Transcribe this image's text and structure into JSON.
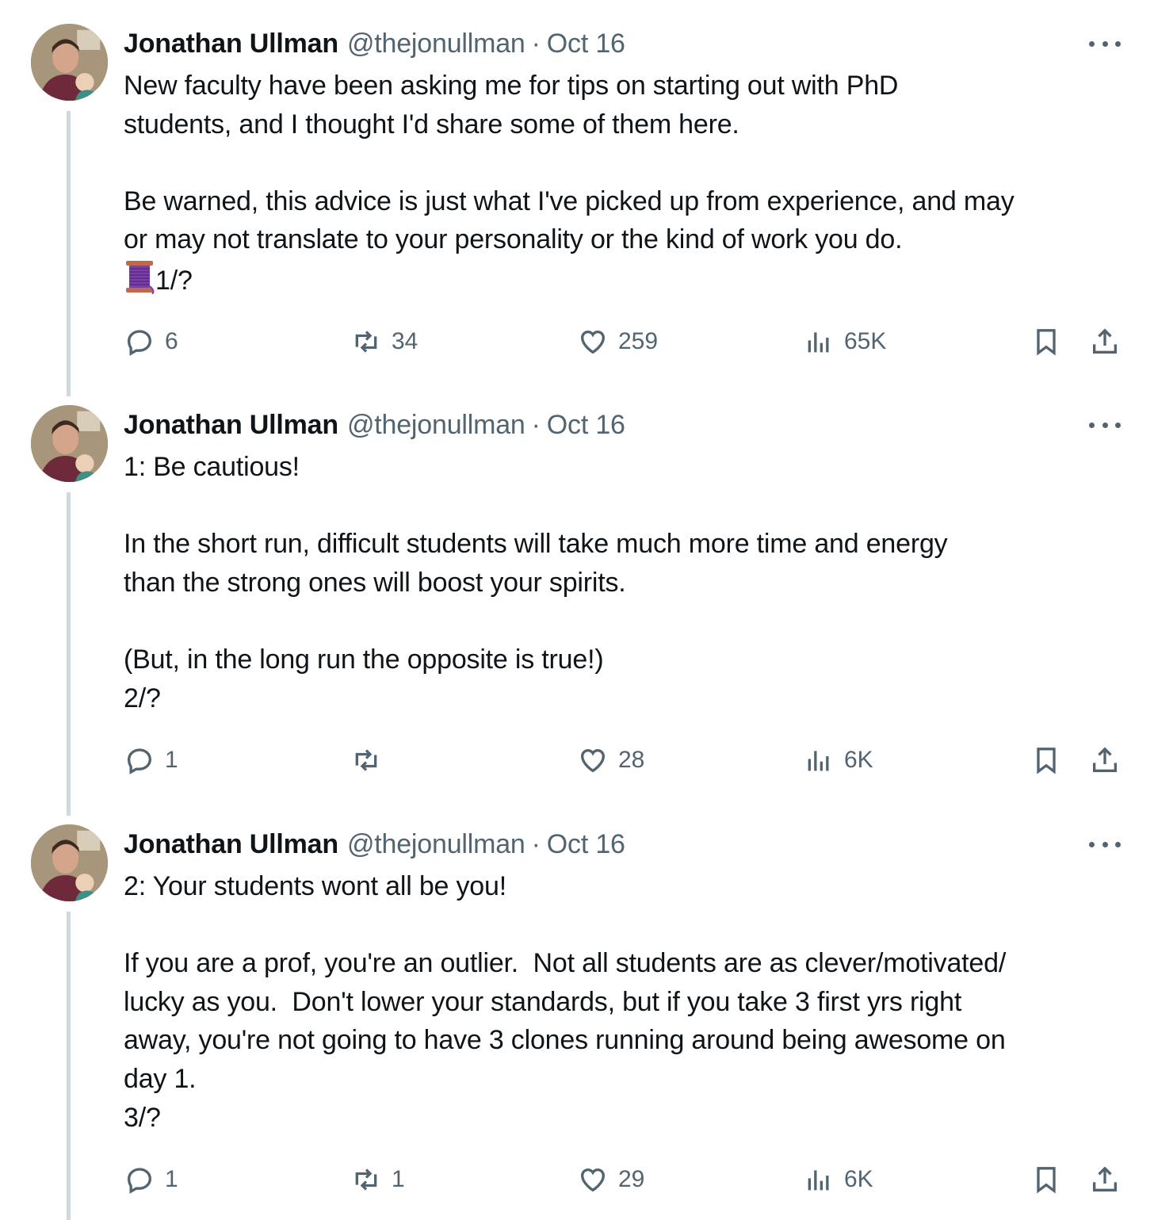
{
  "tweets": [
    {
      "author": {
        "name": "Jonathan Ullman",
        "handle": "@thejonullman",
        "separator": "·",
        "date": "Oct 16"
      },
      "text": "New faculty have been asking me for tips on starting out with PhD\nstudents, and I thought I'd share some of them here.\n\nBe warned, this advice is just what I've picked up from experience, and may\nor may not translate to your personality or the kind of work you do.",
      "thread_marker": "1/?",
      "thread_emoji": "spool-of-thread-icon",
      "replies": "6",
      "reposts": "34",
      "likes": "259",
      "views": "65K"
    },
    {
      "author": {
        "name": "Jonathan Ullman",
        "handle": "@thejonullman",
        "separator": "·",
        "date": "Oct 16"
      },
      "text": "1: Be cautious!\n\nIn the short run, difficult students will take much more time and energy\nthan the strong ones will boost your spirits.\n\n(But, in the long run the opposite is true!)\n2/?",
      "replies": "1",
      "reposts": "",
      "likes": "28",
      "views": "6K"
    },
    {
      "author": {
        "name": "Jonathan Ullman",
        "handle": "@thejonullman",
        "separator": "·",
        "date": "Oct 16"
      },
      "text": "2: Your students wont all be you!\n\nIf you are a prof, you're an outlier.  Not all students are as clever/motivated/\nlucky as you.  Don't lower your standards, but if you take 3 first yrs right\naway, you're not going to have 3 clones running around being awesome on\nday 1.\n3/?",
      "replies": "1",
      "reposts": "1",
      "likes": "29",
      "views": "6K"
    }
  ],
  "colors": {
    "text": "#0f1419",
    "secondary": "#536471",
    "thread_line": "#cfd9de",
    "background": "#ffffff"
  },
  "icons": {
    "reply": "reply-icon",
    "repost": "repost-icon",
    "like": "heart-icon",
    "views": "views-icon",
    "bookmark": "bookmark-icon",
    "share": "share-icon",
    "more": "more-icon"
  }
}
